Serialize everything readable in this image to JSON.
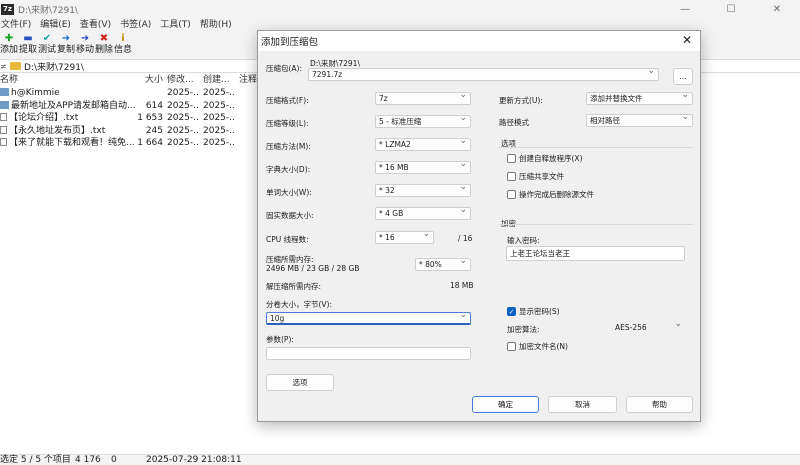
{
  "window": {
    "icon_text": "7z",
    "title": "D:\\来财\\7291\\",
    "minimize_glyph": "—",
    "maximize_glyph": "☐",
    "close_glyph": "✕"
  },
  "menu": [
    "文件(F)",
    "编辑(E)",
    "查看(V)",
    "书签(A)",
    "工具(T)",
    "帮助(H)"
  ],
  "toolbar": [
    {
      "label": "添加",
      "icon": "plus-icon",
      "glyph": "✚",
      "color": "#1aa02a"
    },
    {
      "label": "提取",
      "icon": "minus-icon",
      "glyph": "▬",
      "color": "#2a4fc4"
    },
    {
      "label": "测试",
      "icon": "check-icon",
      "glyph": "✔",
      "color": "#1aa0a0"
    },
    {
      "label": "复制",
      "icon": "copy-arrow-icon",
      "glyph": "➜",
      "color": "#1a6fd0"
    },
    {
      "label": "移动",
      "icon": "move-arrow-icon",
      "glyph": "➜",
      "color": "#2a4fc4"
    },
    {
      "label": "删除",
      "icon": "delete-x-icon",
      "glyph": "✖",
      "color": "#d02020"
    },
    {
      "label": "信息",
      "icon": "info-icon",
      "glyph": "i",
      "color": "#c08a00"
    }
  ],
  "address": {
    "back_glyph": "≠",
    "path": "D:\\来财\\7291\\"
  },
  "columns": {
    "name": "名称",
    "size": "大小",
    "modified": "修改...",
    "created": "创建...",
    "comment": "注释"
  },
  "files": [
    {
      "name": "h@Kimmie",
      "size": "",
      "modified": "2025-...",
      "created": "2025-...",
      "type": "folder"
    },
    {
      "name": "最新地址及APP请发邮箱自动...",
      "size": "614",
      "modified": "2025-...",
      "created": "2025-...",
      "type": "folder"
    },
    {
      "name": "【论坛介绍】.txt",
      "size": "1 653",
      "modified": "2025-...",
      "created": "2025-...",
      "type": "txt"
    },
    {
      "name": "【永久地址发布页】.txt",
      "size": "245",
      "modified": "2025-...",
      "created": "2025-...",
      "type": "txt"
    },
    {
      "name": "【来了就能下载和观看！纯免...",
      "size": "1 664",
      "modified": "2025-...",
      "created": "2025-...",
      "type": "txt"
    }
  ],
  "status": {
    "selected": "选定 5 / 5 个项目",
    "size": "4 176",
    "zero": "0",
    "datetime": "2025-07-29 21:08:11"
  },
  "dialog": {
    "title": "添加到压缩包",
    "close_glyph": "✕",
    "archive_label": "压缩包(A):",
    "archive_dir": "D:\\来财\\7291\\",
    "archive_name": "7291.7z",
    "browse_label": "...",
    "format_label": "压缩格式(F):",
    "format_value": "7z",
    "level_label": "压缩等级(L):",
    "level_value": "5 - 标准压缩",
    "method_label": "压缩方法(M):",
    "method_value": "*  LZMA2",
    "dict_label": "字典大小(D):",
    "dict_value": "*  16 MB",
    "word_label": "单词大小(W):",
    "word_value": "*  32",
    "solid_label": "固实数据大小:",
    "solid_value": "*  4 GB",
    "cpu_label": "CPU 线程数:",
    "cpu_value": "*  16",
    "cpu_total": "/ 16",
    "mem_label": "压缩所需内存:",
    "mem_value": "2496 MB / 23 GB / 28 GB",
    "mem_percent": "* 80%",
    "decomp_label": "解压缩所需内存:",
    "decomp_value": "18 MB",
    "split_label": "分卷大小，字节(V):",
    "split_value": "10g",
    "params_label": "参数(P):",
    "params_value": "",
    "options_button": "选项",
    "update_label": "更新方式(U):",
    "update_value": "添加并替换文件",
    "path_label": "路径模式",
    "path_value": "相对路径",
    "options_group": "选项",
    "opt_sfx": "创建自释放程序(X)",
    "opt_shared": "压缩共享文件",
    "opt_delete": "操作完成后删除源文件",
    "encrypt_group": "加密",
    "password_label": "输入密码:",
    "password_value": "上老王论坛当老王",
    "show_password": "显示密码(S)",
    "enc_method_label": "加密算法:",
    "enc_method_value": "AES-256",
    "encrypt_names": "加密文件名(N)",
    "ok": "确定",
    "cancel": "取消",
    "help": "帮助"
  }
}
